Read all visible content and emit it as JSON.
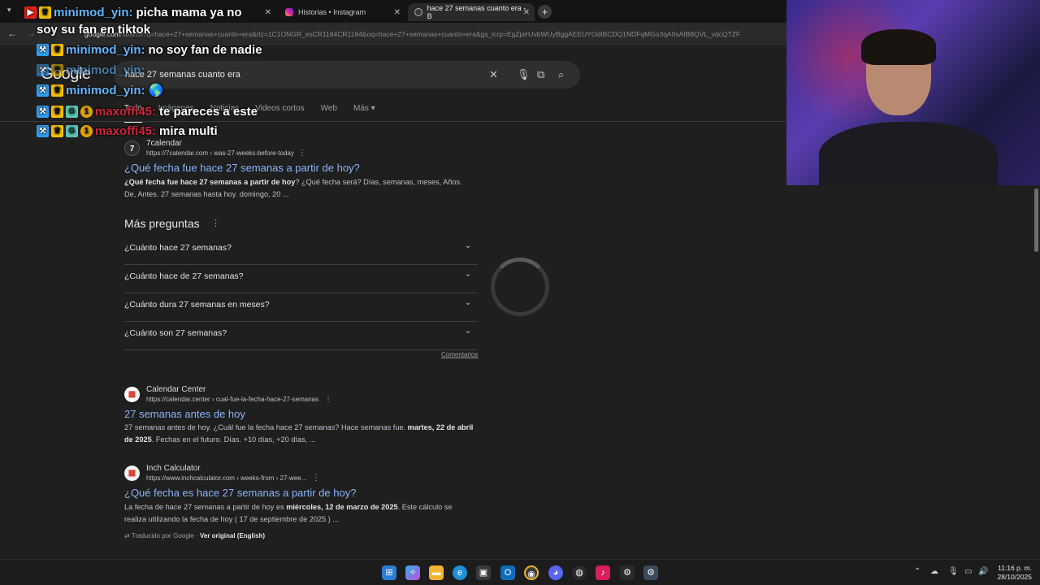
{
  "browser": {
    "tabs": [
      {
        "label": "",
        "active": false
      },
      {
        "label": "Historias • Instagram",
        "active": false
      },
      {
        "label": "hace 27 semanas cuanto era - B",
        "active": true
      }
    ],
    "new_tab": "+",
    "url_host": "google.com",
    "url_path": "/search?q=hace+27+semanas+cuanto+era&rlz=1C1ONGR_esCR1184CR1184&oq=hace+27+semanas+cuanto+era&gs_lcrp=EgZjaHJvbWUyBggAEEUYOdIBCDQ1NDFqMGo3qAIIsAIB8QVL_vdcQTZF"
  },
  "google": {
    "logo": "Google",
    "query": "hace 27 semanas cuanto era",
    "tabs": [
      "Todo",
      "Imágenes",
      "Noticias",
      "Videos cortos",
      "Web",
      "Más"
    ],
    "active_tab": "Todo"
  },
  "results": [
    {
      "site": "7calendar",
      "url": "https://7calendar.com › was-27-weeks-before-today",
      "title": "¿Qué fecha fue hace 27 semanas a partir de hoy?",
      "snippet_bold": "¿Qué fecha fue hace 27 semanas a partir de hoy",
      "snippet": "? ¿Qué fecha será? Días, semanas, meses, Años. De, Antes. 27 semanas hasta hoy. domingo, 20 ..."
    },
    {
      "site": "Calendar Center",
      "url": "https://calendar.center › cual-fue-la-fecha-hace-27-semanas",
      "title": "27 semanas antes de hoy",
      "snippet": "27 semanas antes de hoy. ¿Cuál fue la fecha hace 27 semanas? Hace semanas fue. ",
      "snippet_bold": "martes, 22 de abril de 2025",
      "snippet_tail": ". Fechas en el futuro. Días. +10 días, +20 días, ..."
    },
    {
      "site": "Inch Calculator",
      "url": "https://www.inchcalculator.com › weeks-from › 27-wee...",
      "title": "¿Qué fecha es hace 27 semanas a partir de hoy?",
      "snippet": "La fecha de hace 27 semanas a partir de hoy es ",
      "snippet_bold": "miércoles, 12 de marzo de 2025",
      "snippet_tail": ". Este cálculo se realiza utilizando la fecha de hoy ( 17 de septiembre de 2025 ) ..."
    }
  ],
  "paa": {
    "title": "Más preguntas",
    "questions": [
      "¿Cuánto hace 27 semanas?",
      "¿Cuánto hace de 27 semanas?",
      "¿Cuánto dura 27 semanas en meses?",
      "¿Cuánto son 27 semanas?"
    ],
    "feedback": "Comentarios"
  },
  "translated": {
    "label": "Traducido por Google · ",
    "link": "Ver original (English)"
  },
  "chat": [
    {
      "user": "minimod_yin:",
      "message": "picha mama ya no",
      "badges": [
        "mod",
        "crown"
      ],
      "color": "cyan"
    },
    {
      "user": "",
      "message": "soy su fan en tiktok",
      "badges": [],
      "color": "cyan"
    },
    {
      "user": "minimod_yin:",
      "message": "no soy fan de nadie",
      "badges": [
        "mod",
        "crown"
      ],
      "color": "cyan"
    },
    {
      "user": "minimod_yin:",
      "message": "",
      "badges": [
        "mod",
        "crown"
      ],
      "color": "cyan"
    },
    {
      "user": "minimod_yin:",
      "message": "🌎",
      "badges": [
        "mod",
        "crown"
      ],
      "color": "cyan"
    },
    {
      "user": "maxoffi45:",
      "message": "te pareces a este",
      "badges": [
        "mod",
        "crown",
        "g",
        "one"
      ],
      "color": "red"
    },
    {
      "user": "maxoffi45:",
      "message": "mira multi",
      "badges": [
        "mod",
        "crown",
        "g",
        "one"
      ],
      "color": "red"
    }
  ],
  "clock": {
    "time": "11:16 p. m.",
    "date": "28/10/2025"
  }
}
